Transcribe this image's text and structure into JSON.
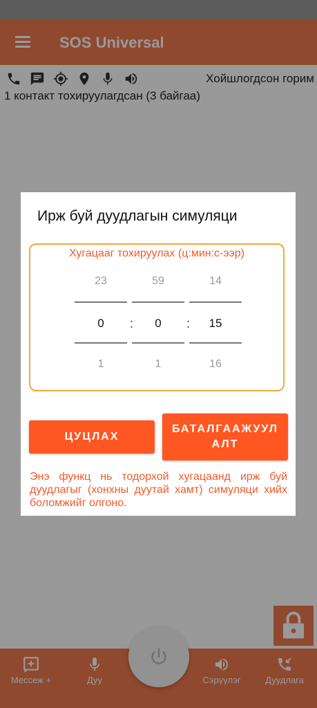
{
  "app": {
    "title": "SOS Universal"
  },
  "status": {
    "mode": "Хойшлогдсон горим",
    "contacts": "1 контакт тохируулагдсан (3 байгаа)",
    "icons": [
      "phone-icon",
      "message-icon",
      "gps-icon",
      "location-pin-icon",
      "microphone-icon",
      "speaker-icon"
    ]
  },
  "dialog": {
    "title": "Ирж буй дуудлагын симуляци",
    "picker_label": "Хугацааг тохируулах (ц:мин:с-ээр)",
    "hours": {
      "prev": "23",
      "current": "0",
      "next": "1"
    },
    "minutes": {
      "prev": "59",
      "current": "0",
      "next": "1"
    },
    "seconds": {
      "prev": "14",
      "current": "15",
      "next": "16"
    },
    "separator": ":",
    "cancel_label": "ЦУЦЛАХ",
    "confirm_label": "БАТАЛГААЖУУЛАЛТ",
    "description": "Энэ функц нь тодорхой хугацаанд ирж буй дуудлагыг (хонхны дуутай хамт) симуляци хийх боломжийг олгоно."
  },
  "bottom_nav": {
    "messages": "Мессеж +",
    "voice": "Дуу",
    "alarm": "Сэрүүлэг",
    "calls": "Дуудлага"
  },
  "colors": {
    "accent": "#ee7a4d",
    "button": "#ff5722",
    "picker_border": "#f2a93b"
  }
}
